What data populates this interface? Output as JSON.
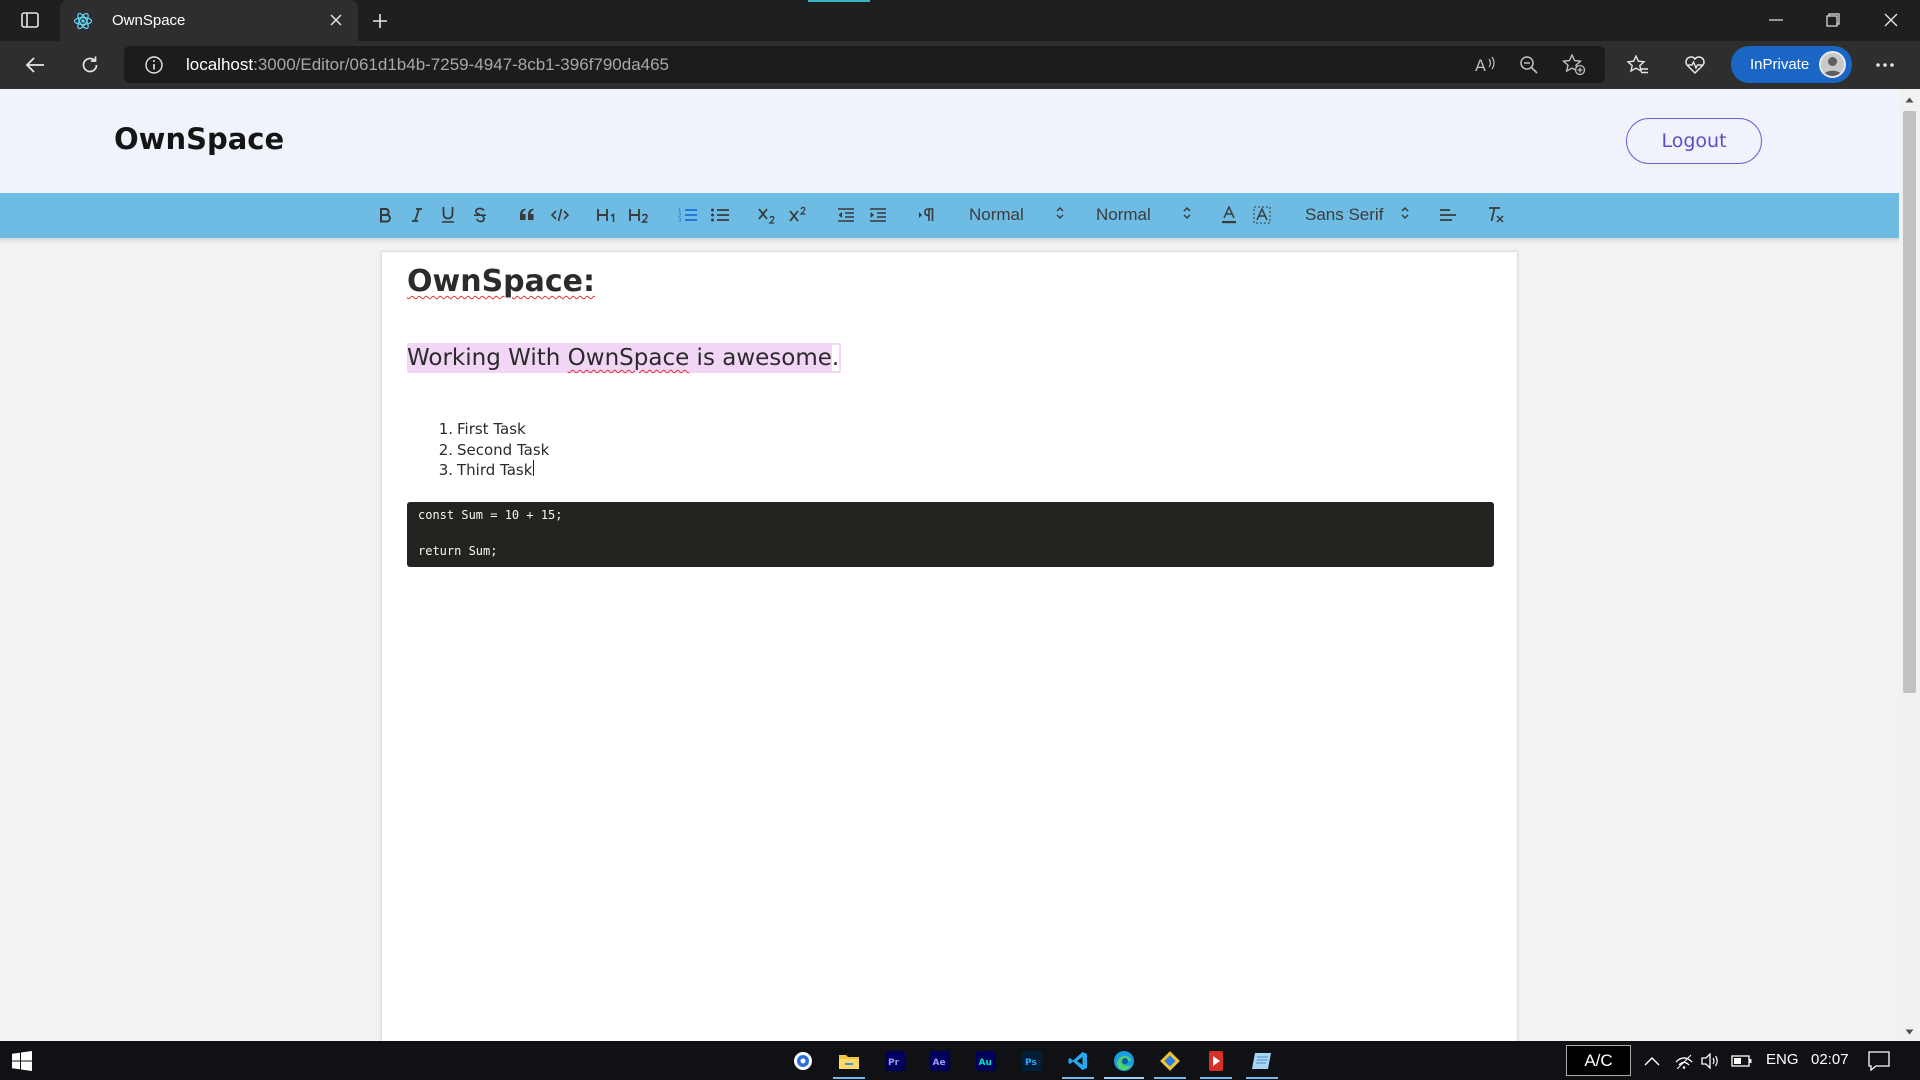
{
  "browser": {
    "tab_title": "OwnSpace",
    "url_host": "localhost",
    "url_path": ":3000/Editor/061d1b4b-7259-4947-8cb1-396f790da465",
    "inprivate_label": "InPrivate"
  },
  "app": {
    "brand": "OwnSpace",
    "logout_label": "Logout"
  },
  "toolbar": {
    "header_picker": "Normal",
    "size_picker": "Normal",
    "font_picker": "Sans Serif"
  },
  "document": {
    "heading": "OwnSpace:",
    "highlight_prefix": "Working With ",
    "highlight_word": "OwnSpace",
    "highlight_suffix": " is awesome",
    "highlight_end": ".",
    "list": [
      {
        "num": "1.",
        "text": "First Task"
      },
      {
        "num": "2.",
        "text": "Second Task"
      },
      {
        "num": "3.",
        "text": "Third Task"
      }
    ],
    "code_line_1": "const Sum = 10 + 15;",
    "code_line_2": "return Sum;"
  },
  "taskbar": {
    "ac_label": "A/C",
    "language": "ENG",
    "time": "02:07"
  },
  "colors": {
    "toolbar_bg": "#6ebce3",
    "header_bg": "#eff4fc",
    "logout_accent": "#6d5fd0",
    "highlight_bg": "#f2d6f6",
    "code_bg": "#23241f",
    "inprivate_bg": "#1a66c4"
  }
}
